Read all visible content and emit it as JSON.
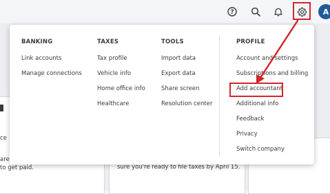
{
  "header": {
    "icons": [
      "help-icon",
      "search-icon",
      "notifications-icon",
      "gear-icon"
    ],
    "avatar_initial": "A"
  },
  "background": {
    "left_text_1": "ce",
    "left_text_2": "are",
    "left_text_3": "to get paid.",
    "middle_text": "sure you're ready to file taxes by April 15."
  },
  "menu": {
    "banking": {
      "title": "BANKING",
      "items": [
        "Link accounts",
        "Manage connections"
      ]
    },
    "taxes": {
      "title": "TAXES",
      "items": [
        "Tax profile",
        "Vehicle info",
        "Home office info",
        "Healthcare"
      ]
    },
    "tools": {
      "title": "TOOLS",
      "items": [
        "Import data",
        "Export data",
        "Share screen",
        "Resolution center"
      ]
    },
    "profile": {
      "title": "PROFILE",
      "items": [
        "Account and settings",
        "Subscriptions and billing",
        "Add accountant",
        "Additional info",
        "Feedback",
        "Privacy",
        "Switch company"
      ]
    }
  },
  "annotation": {
    "color": "#d0262d"
  }
}
